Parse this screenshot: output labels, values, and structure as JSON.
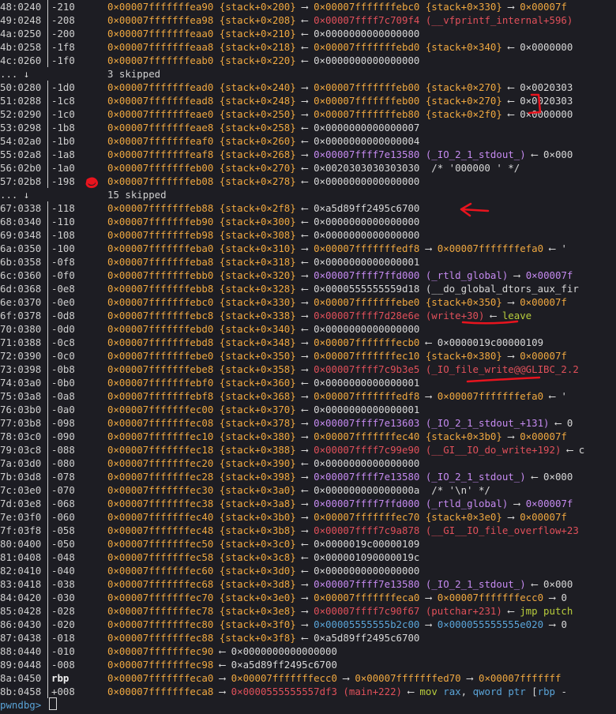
{
  "prompt": {
    "label": "pwndbg>"
  },
  "rows": [
    {
      "type": "entry",
      "idx": "48:0240",
      "off": "-210",
      "tokens": [
        [
          "y",
          "0×00007fffffffea90 {stack+0×200}"
        ],
        [
          "w",
          " ⟶ "
        ],
        [
          "y",
          "0×00007fffffffebc0 {stack+0×330}"
        ],
        [
          "w",
          " ⟶ "
        ],
        [
          "y",
          "0×00007f"
        ]
      ]
    },
    {
      "type": "entry",
      "idx": "49:0248",
      "off": "-208",
      "tokens": [
        [
          "y",
          "0×00007fffffffea98 {stack+0×208}"
        ],
        [
          "w",
          " ⟵ "
        ],
        [
          "r",
          "0×00007ffff7c709f4 (__vfprintf_internal+596)"
        ]
      ]
    },
    {
      "type": "entry",
      "idx": "4a:0250",
      "off": "-200",
      "tokens": [
        [
          "y",
          "0×00007fffffffeaa0 {stack+0×210}"
        ],
        [
          "w",
          " ⟵ 0×0000000000000000"
        ]
      ]
    },
    {
      "type": "entry",
      "idx": "4b:0258",
      "off": "-1f8",
      "tokens": [
        [
          "y",
          "0×00007fffffffeaa8 {stack+0×218}"
        ],
        [
          "w",
          " ⟵ "
        ],
        [
          "y",
          "0×00007fffffffebd0 {stack+0×340}"
        ],
        [
          "w",
          " ⟵ 0×0000000"
        ]
      ]
    },
    {
      "type": "entry",
      "idx": "4c:0260",
      "off": "-1f0",
      "tokens": [
        [
          "y",
          "0×00007fffffffeab0 {stack+0×220}"
        ],
        [
          "w",
          " ⟵ 0×0000000000000000"
        ]
      ]
    },
    {
      "type": "skip",
      "text": "3 skipped",
      "dots": "... ↓"
    },
    {
      "type": "entry",
      "idx": "50:0280",
      "off": "-1d0",
      "tokens": [
        [
          "y",
          "0×00007fffffffead0 {stack+0×240}"
        ],
        [
          "w",
          " ⟶ "
        ],
        [
          "y",
          "0×00007fffffffeb00 {stack+0×270}"
        ],
        [
          "w",
          " ⟵ 0×0020303"
        ]
      ]
    },
    {
      "type": "entry",
      "idx": "51:0288",
      "off": "-1c8",
      "tokens": [
        [
          "y",
          "0×00007fffffffead8 {stack+0×248}"
        ],
        [
          "w",
          " ⟶ "
        ],
        [
          "y",
          "0×00007fffffffeb00 {stack+0×270}"
        ],
        [
          "w",
          " ⟵ 0×0020303"
        ]
      ]
    },
    {
      "type": "entry",
      "idx": "52:0290",
      "off": "-1c0",
      "tokens": [
        [
          "y",
          "0×00007fffffffeae0 {stack+0×250}"
        ],
        [
          "w",
          " ⟶ "
        ],
        [
          "y",
          "0×00007fffffffeb80 {stack+0×2f0}"
        ],
        [
          "w",
          " ⟵ 0×0000000"
        ]
      ]
    },
    {
      "type": "entry",
      "idx": "53:0298",
      "off": "-1b8",
      "tokens": [
        [
          "y",
          "0×00007fffffffeae8 {stack+0×258}"
        ],
        [
          "w",
          " ⟵ 0×0000000000000007"
        ]
      ]
    },
    {
      "type": "entry",
      "idx": "54:02a0",
      "off": "-1b0",
      "tokens": [
        [
          "y",
          "0×00007fffffffeaf0 {stack+0×260}"
        ],
        [
          "w",
          " ⟵ 0×0000000000000004"
        ]
      ]
    },
    {
      "type": "entry",
      "idx": "55:02a8",
      "off": "-1a8",
      "tokens": [
        [
          "y",
          "0×00007fffffffeaf8 {stack+0×268}"
        ],
        [
          "w",
          " ⟶ "
        ],
        [
          "p",
          "0×00007ffff7e13580 (_IO_2_1_stdout_)"
        ],
        [
          "w",
          " ⟵ 0×000"
        ]
      ]
    },
    {
      "type": "entry",
      "idx": "56:02b0",
      "off": "-1a0",
      "tokens": [
        [
          "y",
          "0×00007fffffffeb00 {stack+0×270}"
        ],
        [
          "w",
          " ⟵ 0×0020303030303030  /* '000000 ' */"
        ]
      ]
    },
    {
      "type": "entry",
      "idx": "57:02b8",
      "off": "-198",
      "tokens": [
        [
          "y",
          "0×00007fffffffeb08 {stack+0×278}"
        ],
        [
          "w",
          " ⟵ 0×0000000000000000"
        ]
      ]
    },
    {
      "type": "skip",
      "text": "15 skipped",
      "dots": "... ↓"
    },
    {
      "type": "entry",
      "idx": "67:0338",
      "off": "-118",
      "tokens": [
        [
          "y",
          "0×00007fffffffeb88 {stack+0×2f8}"
        ],
        [
          "w",
          " ⟵ 0×a5d89ff2495c6700"
        ]
      ]
    },
    {
      "type": "entry",
      "idx": "68:0340",
      "off": "-110",
      "tokens": [
        [
          "y",
          "0×00007fffffffeb90 {stack+0×300}"
        ],
        [
          "w",
          " ⟵ 0×0000000000000000"
        ]
      ]
    },
    {
      "type": "entry",
      "idx": "69:0348",
      "off": "-108",
      "tokens": [
        [
          "y",
          "0×00007fffffffeb98 {stack+0×308}"
        ],
        [
          "w",
          " ⟵ 0×0000000000000000"
        ]
      ]
    },
    {
      "type": "entry",
      "idx": "6a:0350",
      "off": "-100",
      "tokens": [
        [
          "y",
          "0×00007fffffffeba0 {stack+0×310}"
        ],
        [
          "w",
          " ⟶ "
        ],
        [
          "y",
          "0×00007fffffffedf8"
        ],
        [
          "w",
          " ⟶ "
        ],
        [
          "y",
          "0×00007fffffffefa0"
        ],
        [
          "w",
          " ⟵ '"
        ]
      ]
    },
    {
      "type": "entry",
      "idx": "6b:0358",
      "off": "-0f8",
      "tokens": [
        [
          "y",
          "0×00007fffffffeba8 {stack+0×318}"
        ],
        [
          "w",
          " ⟵ 0×0000000000000001"
        ]
      ]
    },
    {
      "type": "entry",
      "idx": "6c:0360",
      "off": "-0f0",
      "tokens": [
        [
          "y",
          "0×00007fffffffebb0 {stack+0×320}"
        ],
        [
          "w",
          " ⟶ "
        ],
        [
          "p",
          "0×00007ffff7ffd000 (_rtld_global)"
        ],
        [
          "w",
          " ⟶ "
        ],
        [
          "p",
          "0×00007f"
        ]
      ]
    },
    {
      "type": "entry",
      "idx": "6d:0368",
      "off": "-0e8",
      "tokens": [
        [
          "y",
          "0×00007fffffffebb8 {stack+0×328}"
        ],
        [
          "w",
          " ⟵ 0×0000555555559d18 (__do_global_dtors_aux_fir"
        ]
      ]
    },
    {
      "type": "entry",
      "idx": "6e:0370",
      "off": "-0e0",
      "tokens": [
        [
          "y",
          "0×00007fffffffebc0 {stack+0×330}"
        ],
        [
          "w",
          " ⟶ "
        ],
        [
          "y",
          "0×00007fffffffebe0 {stack+0×350}"
        ],
        [
          "w",
          " ⟶ "
        ],
        [
          "y",
          "0×00007f"
        ]
      ]
    },
    {
      "type": "entry",
      "idx": "6f:0378",
      "off": "-0d8",
      "tokens": [
        [
          "y",
          "0×00007fffffffebc8 {stack+0×338}"
        ],
        [
          "w",
          " ⟶ "
        ],
        [
          "r",
          "0×00007ffff7d28e6e (write+30)"
        ],
        [
          "w",
          " ⟵ "
        ],
        [
          "g",
          "leave"
        ]
      ]
    },
    {
      "type": "entry",
      "idx": "70:0380",
      "off": "-0d0",
      "tokens": [
        [
          "y",
          "0×00007fffffffebd0 {stack+0×340}"
        ],
        [
          "w",
          " ⟵ 0×0000000000000000"
        ]
      ]
    },
    {
      "type": "entry",
      "idx": "71:0388",
      "off": "-0c8",
      "tokens": [
        [
          "y",
          "0×00007fffffffebd8 {stack+0×348}"
        ],
        [
          "w",
          " ⟶ "
        ],
        [
          "y",
          "0×00007fffffffecb0"
        ],
        [
          "w",
          " ⟵ 0×0000019c00000109"
        ]
      ]
    },
    {
      "type": "entry",
      "idx": "72:0390",
      "off": "-0c0",
      "tokens": [
        [
          "y",
          "0×00007fffffffebe0 {stack+0×350}"
        ],
        [
          "w",
          " ⟶ "
        ],
        [
          "y",
          "0×00007fffffffec10 {stack+0×380}"
        ],
        [
          "w",
          " ⟶ "
        ],
        [
          "y",
          "0×00007f"
        ]
      ]
    },
    {
      "type": "entry",
      "idx": "73:0398",
      "off": "-0b8",
      "tokens": [
        [
          "y",
          "0×00007fffffffebe8 {stack+0×358}"
        ],
        [
          "w",
          " ⟶ "
        ],
        [
          "r",
          "0×00007ffff7c9b3e5 (_IO_file_write@@GLIBC_2.2"
        ]
      ]
    },
    {
      "type": "entry",
      "idx": "74:03a0",
      "off": "-0b0",
      "tokens": [
        [
          "y",
          "0×00007fffffffebf0 {stack+0×360}"
        ],
        [
          "w",
          " ⟵ 0×0000000000000001"
        ]
      ]
    },
    {
      "type": "entry",
      "idx": "75:03a8",
      "off": "-0a8",
      "tokens": [
        [
          "y",
          "0×00007fffffffebf8 {stack+0×368}"
        ],
        [
          "w",
          " ⟶ "
        ],
        [
          "y",
          "0×00007fffffffedf8"
        ],
        [
          "w",
          " ⟶ "
        ],
        [
          "y",
          "0×00007fffffffefa0"
        ],
        [
          "w",
          " ⟵ '"
        ]
      ]
    },
    {
      "type": "entry",
      "idx": "76:03b0",
      "off": "-0a0",
      "tokens": [
        [
          "y",
          "0×00007fffffffec00 {stack+0×370}"
        ],
        [
          "w",
          " ⟵ 0×0000000000000001"
        ]
      ]
    },
    {
      "type": "entry",
      "idx": "77:03b8",
      "off": "-098",
      "tokens": [
        [
          "y",
          "0×00007fffffffec08 {stack+0×378}"
        ],
        [
          "w",
          " ⟶ "
        ],
        [
          "p",
          "0×00007ffff7e13603 (_IO_2_1_stdout_+131)"
        ],
        [
          "w",
          " ⟵ 0"
        ]
      ]
    },
    {
      "type": "entry",
      "idx": "78:03c0",
      "off": "-090",
      "tokens": [
        [
          "y",
          "0×00007fffffffec10 {stack+0×380}"
        ],
        [
          "w",
          " ⟶ "
        ],
        [
          "y",
          "0×00007fffffffec40 {stack+0×3b0}"
        ],
        [
          "w",
          " ⟶ "
        ],
        [
          "y",
          "0×00007f"
        ]
      ]
    },
    {
      "type": "entry",
      "idx": "79:03c8",
      "off": "-088",
      "tokens": [
        [
          "y",
          "0×00007fffffffec18 {stack+0×388}"
        ],
        [
          "w",
          " ⟶ "
        ],
        [
          "r",
          "0×00007ffff7c99e90 (__GI__IO_do_write+192)"
        ],
        [
          "w",
          " ⟵ c"
        ]
      ]
    },
    {
      "type": "entry",
      "idx": "7a:03d0",
      "off": "-080",
      "tokens": [
        [
          "y",
          "0×00007fffffffec20 {stack+0×390}"
        ],
        [
          "w",
          " ⟵ 0×0000000000000000"
        ]
      ]
    },
    {
      "type": "entry",
      "idx": "7b:03d8",
      "off": "-078",
      "tokens": [
        [
          "y",
          "0×00007fffffffec28 {stack+0×398}"
        ],
        [
          "w",
          " ⟶ "
        ],
        [
          "p",
          "0×00007ffff7e13580 (_IO_2_1_stdout_)"
        ],
        [
          "w",
          " ⟵ 0×000"
        ]
      ]
    },
    {
      "type": "entry",
      "idx": "7c:03e0",
      "off": "-070",
      "tokens": [
        [
          "y",
          "0×00007fffffffec30 {stack+0×3a0}"
        ],
        [
          "w",
          " ⟵ 0×000000000000000a  /* '\\n' */"
        ]
      ]
    },
    {
      "type": "entry",
      "idx": "7d:03e8",
      "off": "-068",
      "tokens": [
        [
          "y",
          "0×00007fffffffec38 {stack+0×3a8}"
        ],
        [
          "w",
          " ⟶ "
        ],
        [
          "p",
          "0×00007ffff7ffd000 (_rtld_global)"
        ],
        [
          "w",
          " ⟶ "
        ],
        [
          "p",
          "0×00007f"
        ]
      ]
    },
    {
      "type": "entry",
      "idx": "7e:03f0",
      "off": "-060",
      "tokens": [
        [
          "y",
          "0×00007fffffffec40 {stack+0×3b0}"
        ],
        [
          "w",
          " ⟶ "
        ],
        [
          "y",
          "0×00007fffffffec70 {stack+0×3e0}"
        ],
        [
          "w",
          " ⟶ "
        ],
        [
          "y",
          "0×00007f"
        ]
      ]
    },
    {
      "type": "entry",
      "idx": "7f:03f8",
      "off": "-058",
      "tokens": [
        [
          "y",
          "0×00007fffffffec48 {stack+0×3b8}"
        ],
        [
          "w",
          " ⟶ "
        ],
        [
          "r",
          "0×00007ffff7c9a878 (__GI__IO_file_overflow+23"
        ]
      ]
    },
    {
      "type": "entry",
      "idx": "80:0400",
      "off": "-050",
      "tokens": [
        [
          "y",
          "0×00007fffffffec50 {stack+0×3c0}"
        ],
        [
          "w",
          " ⟵ 0×0000019c00000109"
        ]
      ]
    },
    {
      "type": "entry",
      "idx": "81:0408",
      "off": "-048",
      "tokens": [
        [
          "y",
          "0×00007fffffffec58 {stack+0×3c8}"
        ],
        [
          "w",
          " ⟵ 0×000001090000019c"
        ]
      ]
    },
    {
      "type": "entry",
      "idx": "82:0410",
      "off": "-040",
      "tokens": [
        [
          "y",
          "0×00007fffffffec60 {stack+0×3d0}"
        ],
        [
          "w",
          " ⟵ 0×0000000000000000"
        ]
      ]
    },
    {
      "type": "entry",
      "idx": "83:0418",
      "off": "-038",
      "tokens": [
        [
          "y",
          "0×00007fffffffec68 {stack+0×3d8}"
        ],
        [
          "w",
          " ⟶ "
        ],
        [
          "p",
          "0×00007ffff7e13580 (_IO_2_1_stdout_)"
        ],
        [
          "w",
          " ⟵ 0×000"
        ]
      ]
    },
    {
      "type": "entry",
      "idx": "84:0420",
      "off": "-030",
      "tokens": [
        [
          "y",
          "0×00007fffffffec70 {stack+0×3e0}"
        ],
        [
          "w",
          " ⟶ "
        ],
        [
          "y",
          "0×00007fffffffeca0"
        ],
        [
          "w",
          " ⟶ "
        ],
        [
          "y",
          "0×00007fffffffecc0"
        ],
        [
          "w",
          " ⟶ 0"
        ]
      ]
    },
    {
      "type": "entry",
      "idx": "85:0428",
      "off": "-028",
      "tokens": [
        [
          "y",
          "0×00007fffffffec78 {stack+0×3e8}"
        ],
        [
          "w",
          " ⟶ "
        ],
        [
          "r",
          "0×00007ffff7c90f67 (putchar+231)"
        ],
        [
          "w",
          " ⟵ "
        ],
        [
          "g",
          "jmp putch"
        ]
      ]
    },
    {
      "type": "entry",
      "idx": "86:0430",
      "off": "-020",
      "tokens": [
        [
          "y",
          "0×00007fffffffec80 {stack+0×3f0}"
        ],
        [
          "w",
          " ⟶ "
        ],
        [
          "b",
          "0×00005555555b2c00"
        ],
        [
          "w",
          " ⟶ "
        ],
        [
          "b",
          "0×000055555555e020"
        ],
        [
          "w",
          " ⟶ 0"
        ]
      ]
    },
    {
      "type": "entry",
      "idx": "87:0438",
      "off": "-018",
      "tokens": [
        [
          "y",
          "0×00007fffffffec88 {stack+0×3f8}"
        ],
        [
          "w",
          " ⟵ 0×a5d89ff2495c6700"
        ]
      ]
    },
    {
      "type": "entry",
      "idx": "88:0440",
      "off": "-010",
      "tokens": [
        [
          "y",
          "0×00007fffffffec90"
        ],
        [
          "w",
          " ⟵ 0×0000000000000000"
        ]
      ]
    },
    {
      "type": "entry",
      "idx": "89:0448",
      "off": "-008",
      "tokens": [
        [
          "y",
          "0×00007fffffffec98"
        ],
        [
          "w",
          " ⟵ 0×a5d89ff2495c6700"
        ]
      ]
    },
    {
      "type": "entry",
      "idx": "8a:0450",
      "off": "rbp",
      "bold": true,
      "tokens": [
        [
          "y",
          "0×00007fffffffeca0"
        ],
        [
          "w",
          " ⟶ "
        ],
        [
          "y",
          "0×00007fffffffecc0"
        ],
        [
          "w",
          " ⟶ "
        ],
        [
          "y",
          "0×00007fffffffed70"
        ],
        [
          "w",
          " ⟶ "
        ],
        [
          "y",
          "0×00007fffffff"
        ]
      ]
    },
    {
      "type": "entry",
      "idx": "8b:0458",
      "off": "+008",
      "tokens": [
        [
          "y",
          "0×00007fffffffeca8"
        ],
        [
          "w",
          " ⟶ "
        ],
        [
          "r",
          "0×0000555555557df3 (main+222)"
        ],
        [
          "w",
          " ⟵ "
        ],
        [
          "g",
          "mov "
        ],
        [
          "b",
          "rax"
        ],
        [
          "w",
          ", "
        ],
        [
          "b",
          "qword ptr"
        ],
        [
          "w",
          " ["
        ],
        [
          "b",
          "rbp"
        ],
        [
          "w",
          " -"
        ]
      ]
    }
  ],
  "annotation_color": "#e8141e"
}
